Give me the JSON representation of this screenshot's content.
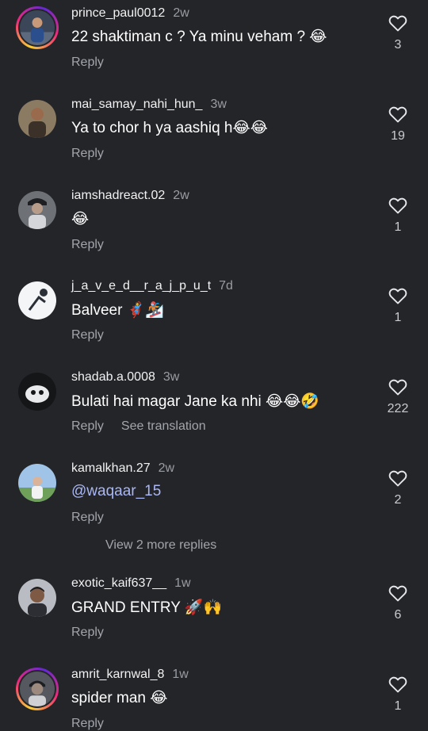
{
  "colors": {
    "background": "#242529",
    "mention": "#a9b7f5",
    "secondary_text": "#a3a5ac"
  },
  "icons": {
    "like": "heart-outline-icon"
  },
  "comments": [
    {
      "username": "prince_paul0012",
      "time": "2w",
      "text": "22 shaktiman c ? Ya minu veham ? 😂",
      "reply": "Reply",
      "likes": "3",
      "story_ring": true
    },
    {
      "username": "mai_samay_nahi_hun_",
      "time": "3w",
      "text": "Ya to chor h ya aashiq h😂😂",
      "reply": "Reply",
      "likes": "19",
      "story_ring": false
    },
    {
      "username": "iamshadreact.02",
      "time": "2w",
      "text": "😂",
      "reply": "Reply",
      "likes": "1",
      "story_ring": false
    },
    {
      "username": "j_a_v_e_d__r_a_j_p_u_t",
      "time": "7d",
      "text": "Balveer 🦸🏂",
      "reply": "Reply",
      "likes": "1",
      "story_ring": false
    },
    {
      "username": "shadab.a.0008",
      "time": "3w",
      "text": "Bulati hai magar Jane ka nhi 😂😂🤣",
      "reply": "Reply",
      "see_translation": "See translation",
      "likes": "222",
      "story_ring": false
    },
    {
      "username": "kamalkhan.27",
      "time": "2w",
      "text": "@waqaar_15",
      "reply": "Reply",
      "likes": "2",
      "story_ring": false
    },
    {
      "username": "exotic_kaif637__",
      "time": "1w",
      "text": "GRAND ENTRY 🚀🙌",
      "reply": "Reply",
      "likes": "6",
      "story_ring": false
    },
    {
      "username": "amrit_karnwal_8",
      "time": "1w",
      "text": "spider man 😂",
      "reply": "Reply",
      "likes": "1",
      "story_ring": true
    }
  ],
  "view_more_replies": "View 2 more replies"
}
